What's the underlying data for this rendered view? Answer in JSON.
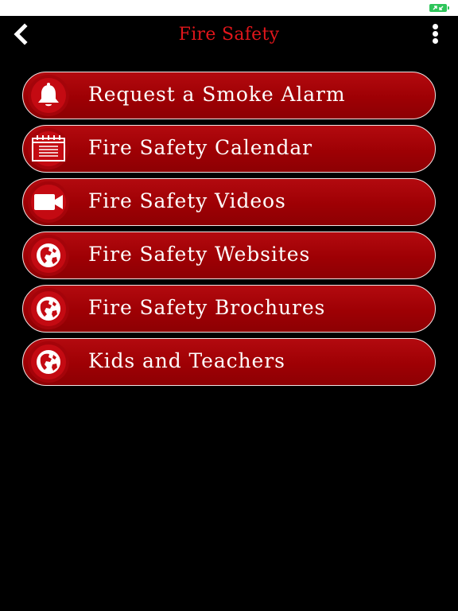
{
  "header": {
    "title": "Fire Safety",
    "title_color": "#e0161b"
  },
  "menu": {
    "items": [
      {
        "label": "Request a Smoke Alarm",
        "icon": "bell-icon"
      },
      {
        "label": "Fire Safety Calendar",
        "icon": "calendar-icon"
      },
      {
        "label": "Fire Safety Videos",
        "icon": "video-camera-icon"
      },
      {
        "label": "Fire Safety Websites",
        "icon": "globe-icon"
      },
      {
        "label": "Fire Safety Brochures",
        "icon": "globe-icon"
      },
      {
        "label": "Kids and Teachers",
        "icon": "globe-icon"
      }
    ],
    "accent_color": "#a00005"
  },
  "status_bar": {
    "battery_color": "#2ec55a"
  }
}
